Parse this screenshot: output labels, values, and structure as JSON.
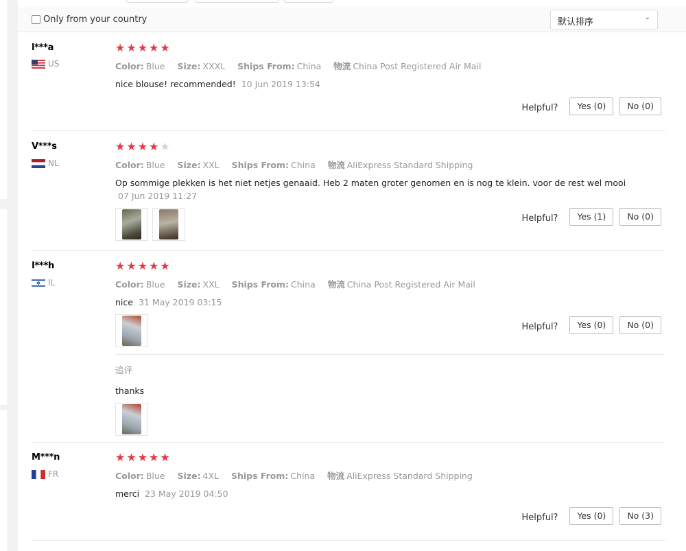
{
  "filter": {
    "only_country_label": "Only from your country",
    "sort_selected": "默认排序"
  },
  "helpful_label": "Helpful?",
  "attr_labels": {
    "color": "Color:",
    "size": "Size:",
    "ships_from": "Ships From:",
    "logistics": "物流"
  },
  "reviews": [
    {
      "user": "l***a",
      "country": "US",
      "stars": 5,
      "color": "Blue",
      "size": "XXXL",
      "ships_from": "China",
      "logistics": "China Post Registered Air Mail",
      "text": "nice blouse! recommended!",
      "date": "10 Jun 2019 13:54",
      "yes": "Yes (0)",
      "no": "No (0)"
    },
    {
      "user": "V***s",
      "country": "NL",
      "stars": 4,
      "color": "Blue",
      "size": "XXL",
      "ships_from": "China",
      "logistics": "AliExpress Standard Shipping",
      "text": "Op sommige plekken is het niet netjes genaaid. Heb 2 maten groter genomen en is nog te klein. voor de rest wel mooi",
      "date": "07 Jun 2019 11:27",
      "yes": "Yes (1)",
      "no": "No (0)"
    },
    {
      "user": "I***h",
      "country": "IL",
      "stars": 5,
      "color": "Blue",
      "size": "XXL",
      "ships_from": "China",
      "logistics": "China Post Registered Air Mail",
      "text": "nice",
      "date": "31 May 2019 03:15",
      "yes": "Yes (0)",
      "no": "No (0)",
      "append_label": "追评",
      "append_text": "thanks"
    },
    {
      "user": "M***n",
      "country": "FR",
      "stars": 5,
      "color": "Blue",
      "size": "4XL",
      "ships_from": "China",
      "logistics": "AliExpress Standard Shipping",
      "text": "merci",
      "date": "23 May 2019 04:50",
      "yes": "Yes (0)",
      "no": "No (3)"
    }
  ],
  "colors": {
    "star": "#e53945",
    "star_off": "#d4d4d4",
    "muted": "#999999"
  }
}
